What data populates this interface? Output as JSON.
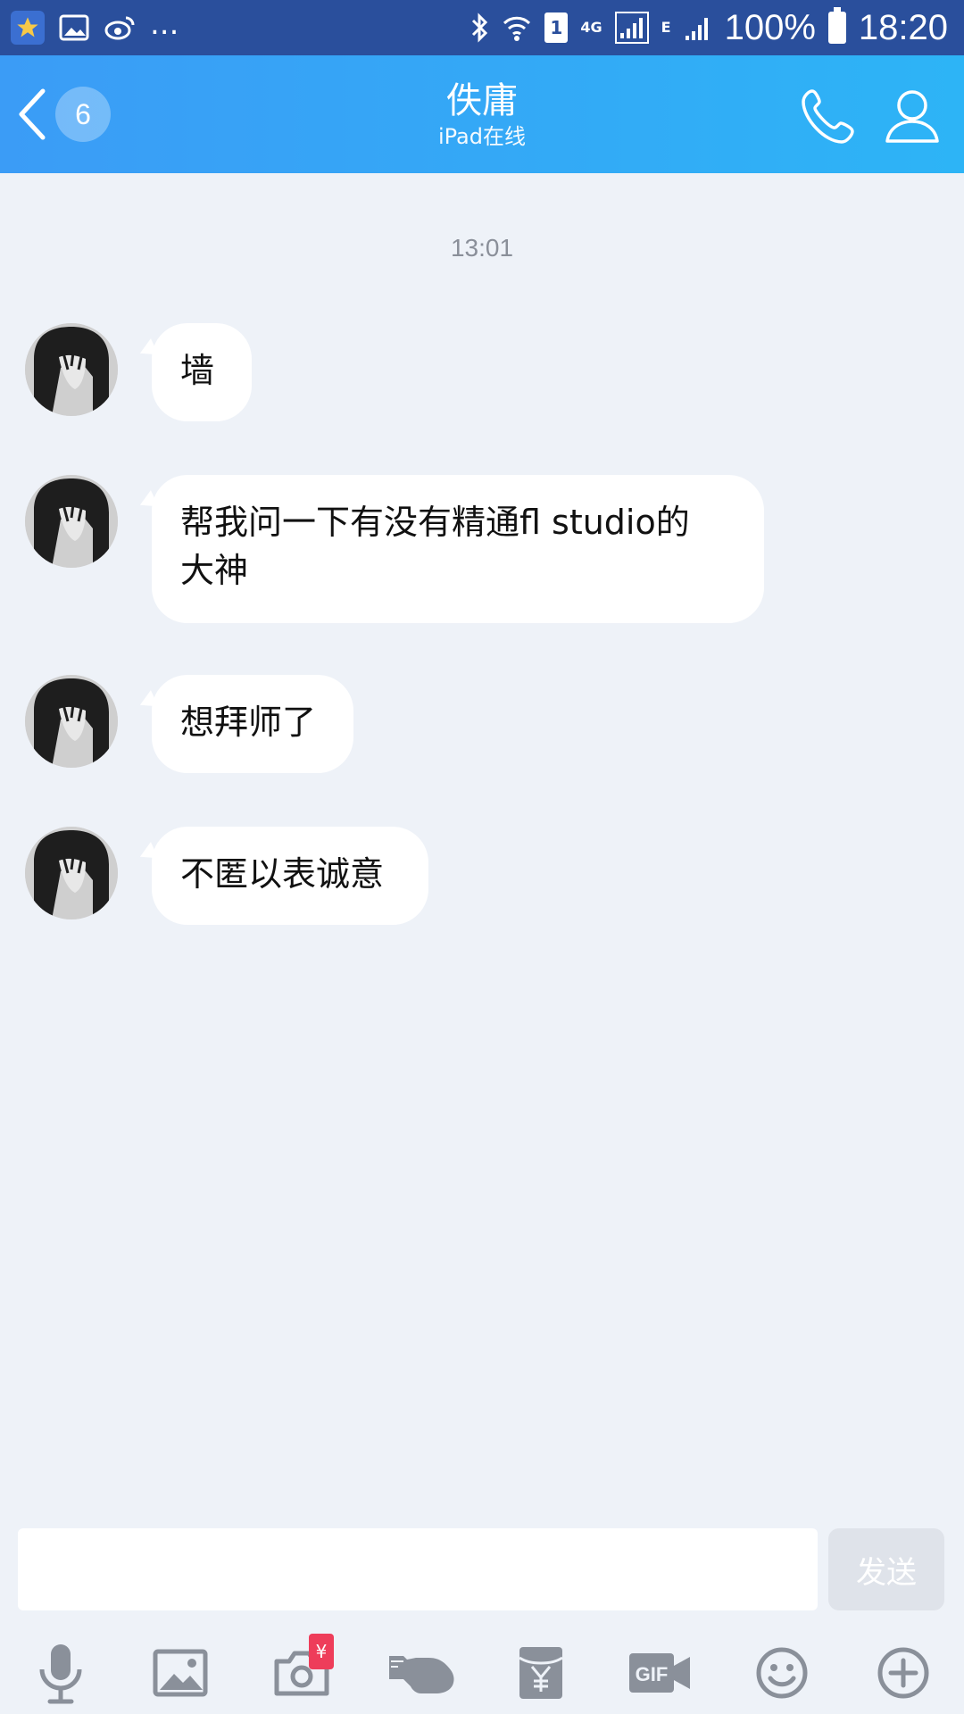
{
  "status_bar": {
    "battery_percent": "100%",
    "time": "18:20",
    "network_label": "4G",
    "network2_label": "E",
    "sim_label": "1",
    "ellipsis": "...",
    "icons": [
      "star-app-icon",
      "gallery-icon",
      "weibo-icon",
      "bluetooth-icon",
      "wifi-icon",
      "signal-icon",
      "battery-icon"
    ]
  },
  "header": {
    "unread_count": "6",
    "contact_name": "佚庸",
    "contact_status": "iPad在线",
    "icons": [
      "back-arrow-icon",
      "phone-icon",
      "profile-icon"
    ]
  },
  "chat": {
    "timestamp": "13:01",
    "messages": [
      {
        "line1": "墙",
        "line2": ""
      },
      {
        "line1": "帮我问一下有没有精通fl studio的",
        "line2": "大神"
      },
      {
        "line1": "想拜师了",
        "line2": ""
      },
      {
        "line1": "不匿以表诚意",
        "line2": ""
      }
    ]
  },
  "input": {
    "value": "",
    "send_label": "发送"
  },
  "toolbar": {
    "camera_badge": "¥",
    "gif_label": "GIF",
    "items": [
      "mic-icon",
      "image-icon",
      "camera-icon",
      "poke-icon",
      "red-packet-icon",
      "gif-icon",
      "emoji-icon",
      "plus-icon"
    ]
  },
  "colors": {
    "header_start": "#3b9cf6",
    "header_end": "#2db4f6",
    "status_bar": "#2a4f9c",
    "chat_bg": "#eef2f8",
    "toolbar_icon": "#8a909a",
    "badge_red": "#ee3d5a"
  }
}
